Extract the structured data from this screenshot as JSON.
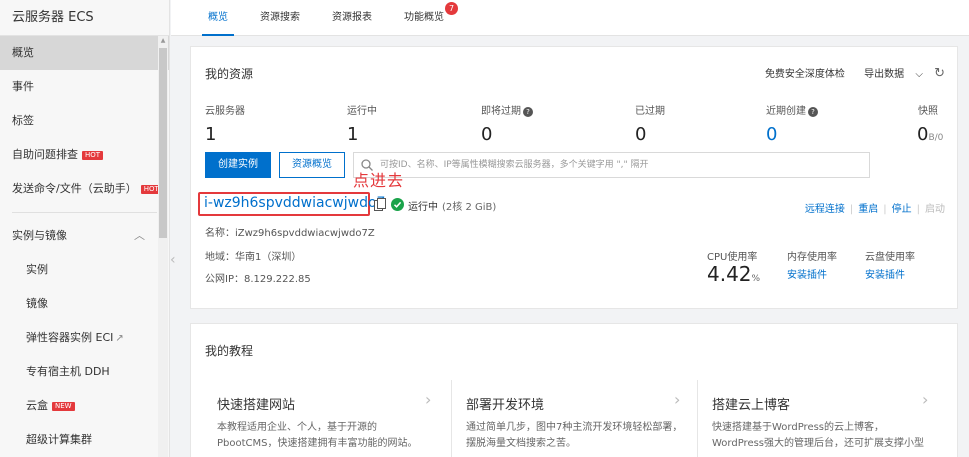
{
  "sidebar": {
    "title": "云服务器 ECS",
    "items": [
      {
        "label": "概览"
      },
      {
        "label": "事件"
      },
      {
        "label": "标签"
      },
      {
        "label": "自助问题排查",
        "badge": "HOT"
      },
      {
        "label": "发送命令/文件（云助手）",
        "badge": "HOT"
      }
    ],
    "group_label": "实例与镜像",
    "sub_items": [
      {
        "label": "实例"
      },
      {
        "label": "镜像"
      },
      {
        "label": "弹性容器实例 ECI",
        "ext": "☐"
      },
      {
        "label": "专有宿主机 DDH"
      },
      {
        "label": "云盒",
        "badge": "NEW"
      },
      {
        "label": "超级计算集群"
      }
    ]
  },
  "tabs": [
    {
      "label": "概览"
    },
    {
      "label": "资源搜索"
    },
    {
      "label": "资源报表"
    },
    {
      "label": "功能概览",
      "badge": "7"
    }
  ],
  "resources": {
    "title": "我的资源",
    "actions": {
      "trial": "免费安全深度体检",
      "export": "导出数据",
      "export_arrow": "⌵"
    },
    "stats": [
      {
        "label": "云服务器",
        "value": "1"
      },
      {
        "label": "运行中",
        "value": "1"
      },
      {
        "label": "即将过期",
        "value": "0"
      },
      {
        "label": "已过期",
        "value": "0"
      },
      {
        "label": "近期创建",
        "value": "0"
      },
      {
        "label": "快照",
        "value": "0",
        "sub": "B/0"
      }
    ],
    "create_button": "创建实例",
    "overview_button": "资源概览",
    "search_placeholder": "可按ID、名称、IP等属性模糊搜索云服务器，多个关键字用 \",\" 隔开",
    "annotation": "点进去",
    "instance": {
      "id": "i-wz9h6spvddwiacwjwdo7",
      "status": "运行中",
      "spec": "(2核 2 GiB)",
      "name_line": "名称：iZwz9h6spvddwiacwjwdo7Z",
      "region_line": "地域：华南1（深圳）",
      "ip_line": "公网IP：8.129.222.85",
      "ops": {
        "remote": "远程连接",
        "restart": "重启",
        "stop": "停止",
        "start": "启动"
      },
      "metrics": {
        "cpu_label": "CPU使用率",
        "cpu_value": "4.42",
        "cpu_unit": "%",
        "mem_label": "内存使用率",
        "mem_link": "安装插件",
        "disk_label": "云盘使用率",
        "disk_link": "安装插件"
      }
    }
  },
  "tutorials": {
    "title": "我的教程",
    "items": [
      {
        "title": "快速搭建网站",
        "desc1": "本教程适用企业、个人，基于开源的",
        "desc2": "PbootCMS，快速搭建拥有丰富功能的网站。"
      },
      {
        "title": "部署开发环境",
        "desc1": "通过简单几步，图中7种主流开发环境轻松部署，",
        "desc2": "摆脱海量文档搜索之苦。"
      },
      {
        "title": "搭建云上博客",
        "desc1": "快速搭建基于WordPress的云上博客，",
        "desc2": "WordPress强大的管理后台，还可扩展支撑小型"
      }
    ]
  },
  "colors": {
    "accent": "#0070cc",
    "danger": "#e4393c",
    "success": "#1aa34a"
  }
}
